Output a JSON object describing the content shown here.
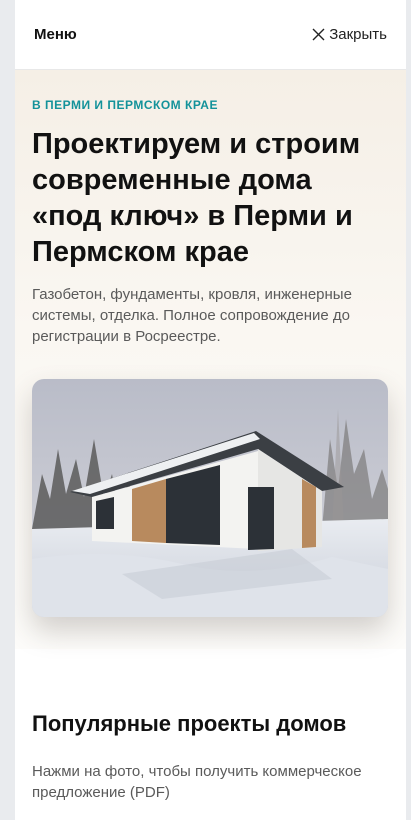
{
  "menu": {
    "title": "Меню",
    "close_label": "Закрыть"
  },
  "hero": {
    "eyebrow": "В ПЕРМИ И ПЕРМСКОМ КРАЕ",
    "headline": "Проектируем и строим современные дома «под ключ» в Перми и Пермском крае",
    "subtext": "Газобетон, фундаменты, кровля, инженерные системы, отделка. Полное сопровождение до регистрации в Росреестре."
  },
  "popular": {
    "title": "Популярные проекты домов",
    "subtitle": "Нажми на фото, чтобы получить коммерческое предложение (PDF)"
  },
  "colors": {
    "accent": "#13929a",
    "heading": "#111111",
    "body_text": "#5a5a5a"
  },
  "icons": {
    "close": "close-icon"
  }
}
